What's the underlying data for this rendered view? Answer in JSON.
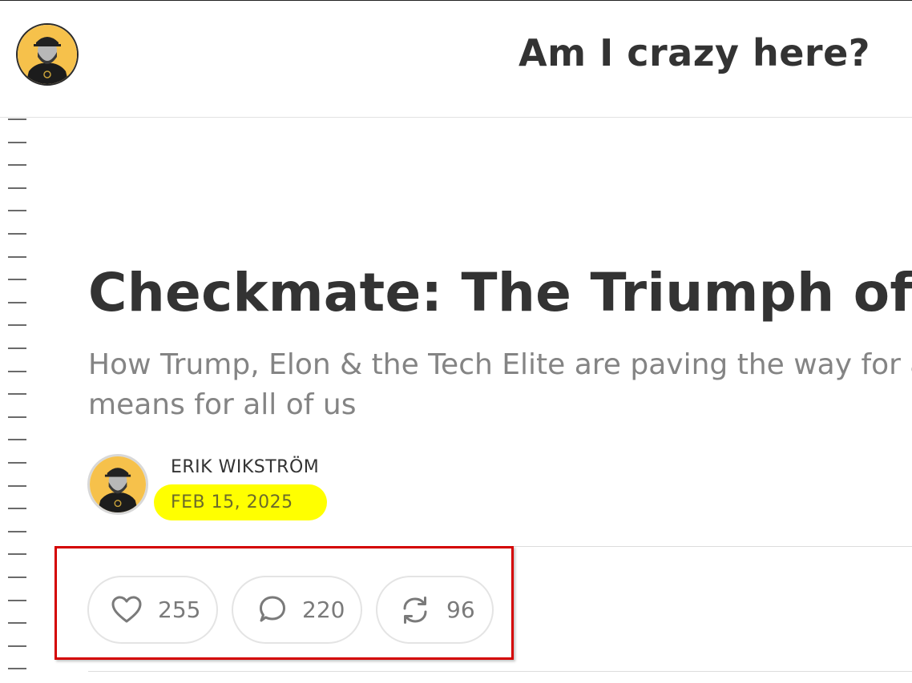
{
  "header": {
    "title": "Am I crazy here?"
  },
  "post": {
    "title": "Checkmate: The Triumph of Tech",
    "subtitle": "How Trump, Elon & the Tech Elite are paving the way for a Br means for all of us",
    "author": "ERIK WIKSTRÖM",
    "date": "FEB 15, 2025"
  },
  "actions": {
    "likes": "255",
    "comments": "220",
    "restacks": "96"
  },
  "colors": {
    "date_highlight": "#ffff00",
    "annotation_box": "#d40000",
    "avatar_background": "#f6c14b"
  },
  "icons": {
    "like": "heart-icon",
    "comment": "comment-bubble-icon",
    "restack": "restack-arrows-icon"
  }
}
